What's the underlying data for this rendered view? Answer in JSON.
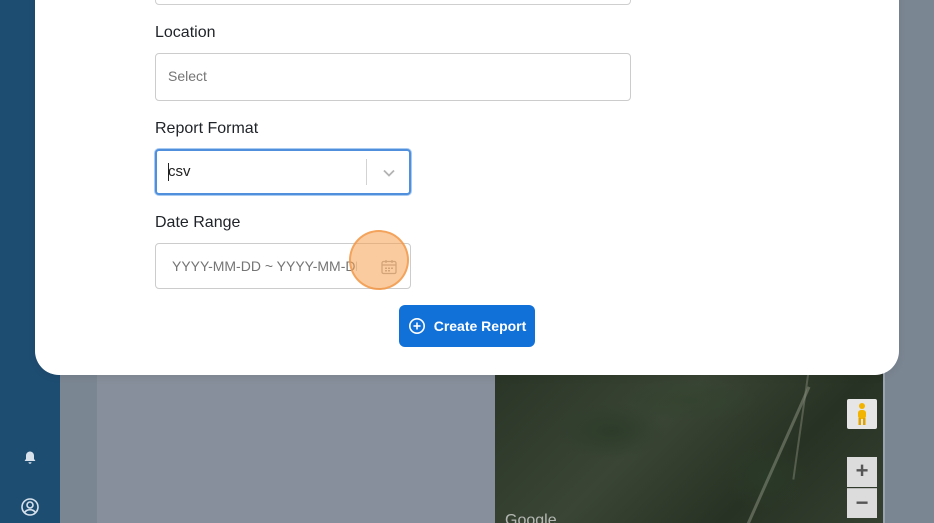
{
  "form": {
    "location": {
      "label": "Location",
      "placeholder": "Select"
    },
    "report_format": {
      "label": "Report Format",
      "value": "csv"
    },
    "date_range": {
      "label": "Date Range",
      "placeholder": "YYYY-MM-DD ~ YYYY-MM-DD"
    },
    "submit_label": "Create Report"
  },
  "map": {
    "zoom_in": "+",
    "zoom_out": "−",
    "attribution": "Google"
  },
  "icons": {
    "sidebar": [
      "bell-icon",
      "user-circle-icon"
    ],
    "format_dropdown": "chevron-down-icon",
    "date_picker": "calendar-icon",
    "create_button": "plus-circle-icon",
    "map_control": "pegman-icon"
  },
  "colors": {
    "primary": "#1271d8",
    "focus_border": "#4f8fdc",
    "sidebar": "#1e4d72",
    "cursor_highlight": "#f5a050"
  }
}
